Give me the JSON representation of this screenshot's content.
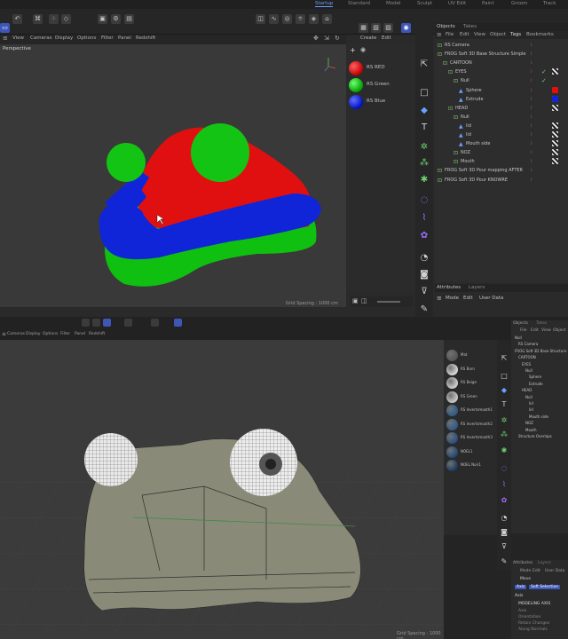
{
  "layout_tabs": [
    "Startup",
    "Standard",
    "Model",
    "Sculpt",
    "UV Edit",
    "Paint",
    "Groom",
    "Track"
  ],
  "active_layout": "Startup",
  "viewport_menu": [
    "View",
    "Cameras",
    "Display",
    "Options",
    "Filter",
    "Panel",
    "Redshift"
  ],
  "viewport_label": "Perspective",
  "grid_spacing_top": "Grid Spacing : 1000 cm",
  "grid_spacing_bottom": "Grid Spacing : 1000 cm",
  "materials_top": [
    {
      "name": "RS RED",
      "color": "#e01010"
    },
    {
      "name": "RS Green",
      "color": "#10c010"
    },
    {
      "name": "RS Blue",
      "color": "#1020d0"
    }
  ],
  "mat_toolbar": {
    "create": "Create",
    "edit": "Edit",
    "view": "View"
  },
  "om_tabs": {
    "objects": "Objects",
    "takes": "Takes"
  },
  "om_menu": [
    "File",
    "Edit",
    "View",
    "Object",
    "Tags",
    "Bookmarks"
  ],
  "objects_top": [
    {
      "name": "RS Camera",
      "indent": 0
    },
    {
      "name": "FROG Soft 3D Base Structure Simple",
      "indent": 0
    },
    {
      "name": "CARTOON",
      "indent": 1
    },
    {
      "name": "EYES",
      "indent": 2
    },
    {
      "name": "Null",
      "indent": 3
    },
    {
      "name": "Sphere",
      "indent": 4
    },
    {
      "name": "Extrude",
      "indent": 4
    },
    {
      "name": "HEAD",
      "indent": 2
    },
    {
      "name": "Null",
      "indent": 3
    },
    {
      "name": "lid",
      "indent": 4
    },
    {
      "name": "lid",
      "indent": 4
    },
    {
      "name": "Mouth side",
      "indent": 4
    },
    {
      "name": "NOZ",
      "indent": 3
    },
    {
      "name": "Mouth",
      "indent": 3
    },
    {
      "name": "FROG Soft 3D Pour mapping AFTER",
      "indent": 0
    },
    {
      "name": "FROG Soft 3D Pour KNOWRE",
      "indent": 0
    }
  ],
  "attr_tabs": {
    "attributes": "Attributes",
    "layers": "Layers"
  },
  "attr_menu": [
    "Mode",
    "Edit",
    "User Data"
  ],
  "materials_bottom": [
    {
      "name": "Mat",
      "color": "#555555"
    },
    {
      "name": "RS Barn",
      "color": "#d9d9d9"
    },
    {
      "name": "RS Beige",
      "color": "#cfcfcf"
    },
    {
      "name": "RS Green",
      "color": "#c8c8c8"
    },
    {
      "name": "RS Invertsmooth1",
      "color": "#2d5a8a"
    },
    {
      "name": "RS Invertsmooth2",
      "color": "#2d5a8a"
    },
    {
      "name": "RS Invertsmooth3",
      "color": "#2a4f80"
    },
    {
      "name": "NOEL1",
      "color": "#204878"
    },
    {
      "name": "NOEL Noir1",
      "color": "#1a3a60"
    }
  ],
  "objects_bottom": [
    {
      "name": "Null",
      "indent": 0
    },
    {
      "name": "RS Camera",
      "indent": 1
    },
    {
      "name": "FROG Soft 3D Base Structure",
      "indent": 0
    },
    {
      "name": "CARTOON",
      "indent": 1
    },
    {
      "name": "EYES",
      "indent": 2
    },
    {
      "name": "Null",
      "indent": 3
    },
    {
      "name": "Sphere",
      "indent": 4
    },
    {
      "name": "Extrude",
      "indent": 4
    },
    {
      "name": "HEAD",
      "indent": 2
    },
    {
      "name": "Null",
      "indent": 3
    },
    {
      "name": "lid",
      "indent": 4
    },
    {
      "name": "lid",
      "indent": 4
    },
    {
      "name": "Mouth side",
      "indent": 4
    },
    {
      "name": "NOZ",
      "indent": 3
    },
    {
      "name": "Mouth",
      "indent": 3
    },
    {
      "name": "Structure Overlaps",
      "indent": 1
    }
  ],
  "attr_bottom": {
    "tabs": [
      "Attributes",
      "Layers"
    ],
    "menu": [
      "Mode",
      "Edit",
      "User Data"
    ],
    "object_label": "Move",
    "pills": [
      "Axis",
      "Soft Selection"
    ],
    "section": "Axis",
    "subsection": "MODELING AXIS",
    "rows": [
      "Axis",
      "Orientation",
      "Retain Changes",
      "Along Normals"
    ]
  }
}
